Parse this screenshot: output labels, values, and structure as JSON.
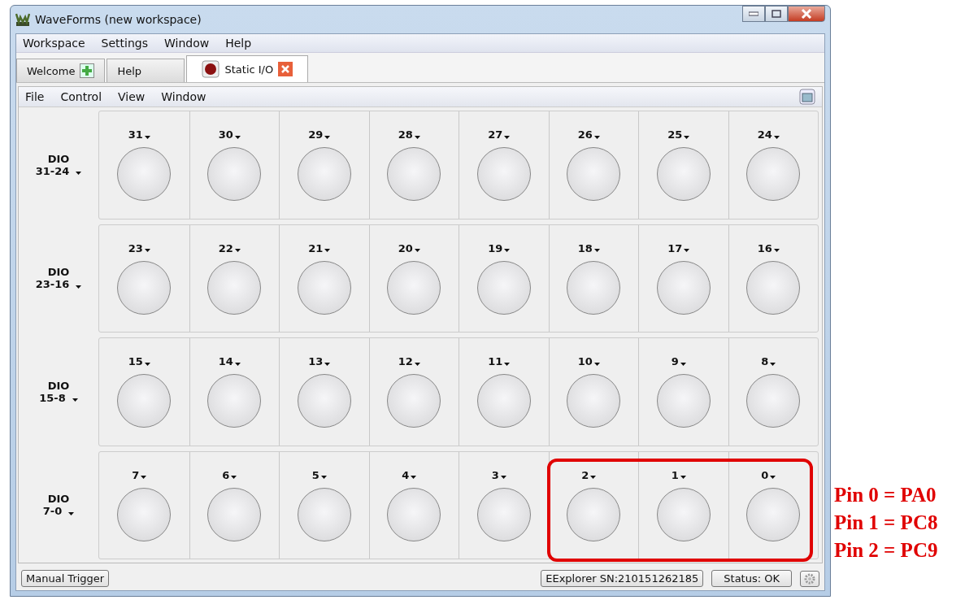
{
  "window": {
    "title": "WaveForms  (new workspace)"
  },
  "menu": [
    "Workspace",
    "Settings",
    "Window",
    "Help"
  ],
  "tabs": [
    {
      "label": "Welcome",
      "kind": "add",
      "selected": false
    },
    {
      "label": "Help",
      "kind": "plain",
      "selected": false
    },
    {
      "label": "Static I/O",
      "kind": "device",
      "selected": true
    }
  ],
  "tool_menu": [
    "File",
    "Control",
    "View",
    "Window"
  ],
  "groups": [
    {
      "label": "DIO",
      "range": "31-24",
      "pins": [
        {
          "label": "31",
          "on": false
        },
        {
          "label": "30",
          "on": false
        },
        {
          "label": "29",
          "on": false
        },
        {
          "label": "28",
          "on": false
        },
        {
          "label": "27",
          "on": false
        },
        {
          "label": "26",
          "on": false
        },
        {
          "label": "25",
          "on": false
        },
        {
          "label": "24",
          "on": false
        }
      ]
    },
    {
      "label": "DIO",
      "range": "23-16",
      "pins": [
        {
          "label": "23",
          "on": false
        },
        {
          "label": "22",
          "on": false
        },
        {
          "label": "21",
          "on": false
        },
        {
          "label": "20",
          "on": false
        },
        {
          "label": "19",
          "on": false
        },
        {
          "label": "18",
          "on": false
        },
        {
          "label": "17",
          "on": false
        },
        {
          "label": "16",
          "on": false
        }
      ]
    },
    {
      "label": "DIO",
      "range": "15-8",
      "pins": [
        {
          "label": "15",
          "on": false
        },
        {
          "label": "14",
          "on": false
        },
        {
          "label": "13",
          "on": false
        },
        {
          "label": "12",
          "on": false
        },
        {
          "label": "11",
          "on": false
        },
        {
          "label": "10",
          "on": false
        },
        {
          "label": "9",
          "on": false
        },
        {
          "label": "8",
          "on": false
        }
      ]
    },
    {
      "label": "DIO",
      "range": "7-0",
      "pins": [
        {
          "label": "7",
          "on": false
        },
        {
          "label": "6",
          "on": false
        },
        {
          "label": "5",
          "on": false
        },
        {
          "label": "4",
          "on": false
        },
        {
          "label": "3",
          "on": false
        },
        {
          "label": "2",
          "on": false
        },
        {
          "label": "1",
          "on": false
        },
        {
          "label": "0",
          "on": false
        }
      ]
    }
  ],
  "status_bar": {
    "trigger": "Manual Trigger",
    "device": "EExplorer SN:210151262185",
    "status": "Status: OK"
  },
  "notes": [
    "Pin 0 = PA0",
    "Pin 1 = PC8",
    "Pin 2 = PC9"
  ]
}
